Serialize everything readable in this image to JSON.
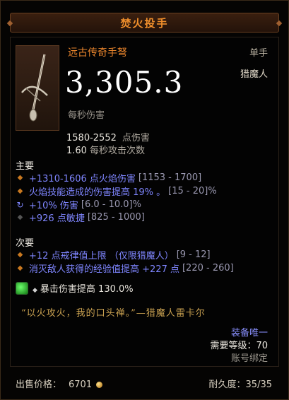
{
  "item": {
    "name": "焚火投手",
    "type": "远古传奇手弩",
    "slot": "单手",
    "class": "猎魔人",
    "dps": "3,305.3",
    "dps_label": "每秒伤害",
    "damage_range": "1580-2552",
    "damage_label": "点伤害",
    "attack_speed": "1.60",
    "attack_speed_label": "每秒攻击次数",
    "icon": "hand-crossbow-icon"
  },
  "primary": {
    "header": "主要",
    "affixes": [
      {
        "text": "+1310-1606 点火焰伤害",
        "range": "[1153 - 1700]",
        "bullet": "diamond"
      },
      {
        "text": "火焰技能造成的伤害提高 19% 。",
        "range": "[15 - 20]%",
        "bullet": "diamond"
      },
      {
        "text": "+10% 伤害",
        "range": "[6.0 - 10.0]%",
        "bullet": "enchant"
      },
      {
        "text": "+926 点敏捷",
        "range": "[825 - 1000]",
        "bullet": "diamond-dark"
      }
    ]
  },
  "secondary": {
    "header": "次要",
    "affixes": [
      {
        "text": "+12 点戒律值上限 （仅限猎魔人）",
        "range": "[9 - 12]",
        "bullet": "diamond"
      },
      {
        "text": "消灭敌人获得的经验值提高 +227 点",
        "range": "[220 - 260]",
        "bullet": "diamond"
      }
    ]
  },
  "socket": {
    "gem_icon": "green-gem-icon",
    "text": "暴击伤害提高 130.0%"
  },
  "flavor": "“以火攻火，我的口头禅。”—猎魔人雷卡尔",
  "footer": {
    "equip_unique": "装备唯一",
    "required_level": "需要等级：70",
    "account_bound": "账号绑定",
    "sell_label": "出售价格：",
    "sell_value": "6701",
    "durability_label": "耐久度：",
    "durability_value": "35/35"
  },
  "colors": {
    "legendary": "#e8842c",
    "magic": "#7f86ff",
    "flavor": "#c8a050"
  }
}
